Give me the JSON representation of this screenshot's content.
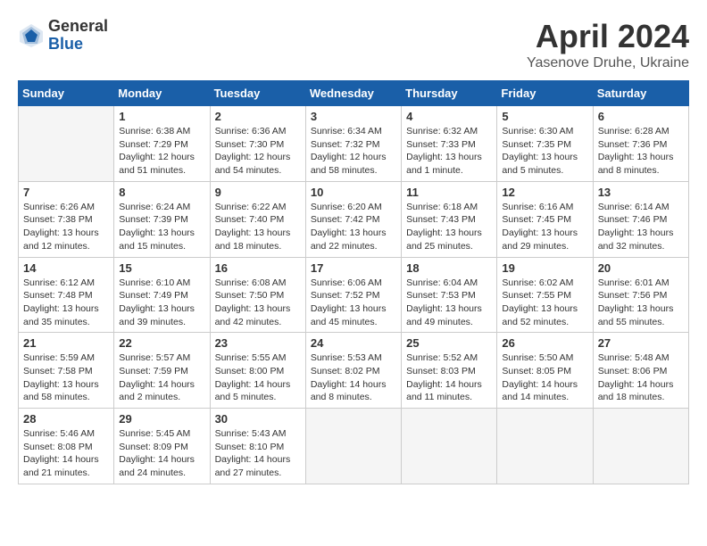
{
  "logo": {
    "general": "General",
    "blue": "Blue"
  },
  "title": {
    "month": "April 2024",
    "location": "Yasenove Druhe, Ukraine"
  },
  "calendar": {
    "headers": [
      "Sunday",
      "Monday",
      "Tuesday",
      "Wednesday",
      "Thursday",
      "Friday",
      "Saturday"
    ],
    "weeks": [
      [
        {
          "day": "",
          "info": ""
        },
        {
          "day": "1",
          "info": "Sunrise: 6:38 AM\nSunset: 7:29 PM\nDaylight: 12 hours\nand 51 minutes."
        },
        {
          "day": "2",
          "info": "Sunrise: 6:36 AM\nSunset: 7:30 PM\nDaylight: 12 hours\nand 54 minutes."
        },
        {
          "day": "3",
          "info": "Sunrise: 6:34 AM\nSunset: 7:32 PM\nDaylight: 12 hours\nand 58 minutes."
        },
        {
          "day": "4",
          "info": "Sunrise: 6:32 AM\nSunset: 7:33 PM\nDaylight: 13 hours\nand 1 minute."
        },
        {
          "day": "5",
          "info": "Sunrise: 6:30 AM\nSunset: 7:35 PM\nDaylight: 13 hours\nand 5 minutes."
        },
        {
          "day": "6",
          "info": "Sunrise: 6:28 AM\nSunset: 7:36 PM\nDaylight: 13 hours\nand 8 minutes."
        }
      ],
      [
        {
          "day": "7",
          "info": "Sunrise: 6:26 AM\nSunset: 7:38 PM\nDaylight: 13 hours\nand 12 minutes."
        },
        {
          "day": "8",
          "info": "Sunrise: 6:24 AM\nSunset: 7:39 PM\nDaylight: 13 hours\nand 15 minutes."
        },
        {
          "day": "9",
          "info": "Sunrise: 6:22 AM\nSunset: 7:40 PM\nDaylight: 13 hours\nand 18 minutes."
        },
        {
          "day": "10",
          "info": "Sunrise: 6:20 AM\nSunset: 7:42 PM\nDaylight: 13 hours\nand 22 minutes."
        },
        {
          "day": "11",
          "info": "Sunrise: 6:18 AM\nSunset: 7:43 PM\nDaylight: 13 hours\nand 25 minutes."
        },
        {
          "day": "12",
          "info": "Sunrise: 6:16 AM\nSunset: 7:45 PM\nDaylight: 13 hours\nand 29 minutes."
        },
        {
          "day": "13",
          "info": "Sunrise: 6:14 AM\nSunset: 7:46 PM\nDaylight: 13 hours\nand 32 minutes."
        }
      ],
      [
        {
          "day": "14",
          "info": "Sunrise: 6:12 AM\nSunset: 7:48 PM\nDaylight: 13 hours\nand 35 minutes."
        },
        {
          "day": "15",
          "info": "Sunrise: 6:10 AM\nSunset: 7:49 PM\nDaylight: 13 hours\nand 39 minutes."
        },
        {
          "day": "16",
          "info": "Sunrise: 6:08 AM\nSunset: 7:50 PM\nDaylight: 13 hours\nand 42 minutes."
        },
        {
          "day": "17",
          "info": "Sunrise: 6:06 AM\nSunset: 7:52 PM\nDaylight: 13 hours\nand 45 minutes."
        },
        {
          "day": "18",
          "info": "Sunrise: 6:04 AM\nSunset: 7:53 PM\nDaylight: 13 hours\nand 49 minutes."
        },
        {
          "day": "19",
          "info": "Sunrise: 6:02 AM\nSunset: 7:55 PM\nDaylight: 13 hours\nand 52 minutes."
        },
        {
          "day": "20",
          "info": "Sunrise: 6:01 AM\nSunset: 7:56 PM\nDaylight: 13 hours\nand 55 minutes."
        }
      ],
      [
        {
          "day": "21",
          "info": "Sunrise: 5:59 AM\nSunset: 7:58 PM\nDaylight: 13 hours\nand 58 minutes."
        },
        {
          "day": "22",
          "info": "Sunrise: 5:57 AM\nSunset: 7:59 PM\nDaylight: 14 hours\nand 2 minutes."
        },
        {
          "day": "23",
          "info": "Sunrise: 5:55 AM\nSunset: 8:00 PM\nDaylight: 14 hours\nand 5 minutes."
        },
        {
          "day": "24",
          "info": "Sunrise: 5:53 AM\nSunset: 8:02 PM\nDaylight: 14 hours\nand 8 minutes."
        },
        {
          "day": "25",
          "info": "Sunrise: 5:52 AM\nSunset: 8:03 PM\nDaylight: 14 hours\nand 11 minutes."
        },
        {
          "day": "26",
          "info": "Sunrise: 5:50 AM\nSunset: 8:05 PM\nDaylight: 14 hours\nand 14 minutes."
        },
        {
          "day": "27",
          "info": "Sunrise: 5:48 AM\nSunset: 8:06 PM\nDaylight: 14 hours\nand 18 minutes."
        }
      ],
      [
        {
          "day": "28",
          "info": "Sunrise: 5:46 AM\nSunset: 8:08 PM\nDaylight: 14 hours\nand 21 minutes."
        },
        {
          "day": "29",
          "info": "Sunrise: 5:45 AM\nSunset: 8:09 PM\nDaylight: 14 hours\nand 24 minutes."
        },
        {
          "day": "30",
          "info": "Sunrise: 5:43 AM\nSunset: 8:10 PM\nDaylight: 14 hours\nand 27 minutes."
        },
        {
          "day": "",
          "info": ""
        },
        {
          "day": "",
          "info": ""
        },
        {
          "day": "",
          "info": ""
        },
        {
          "day": "",
          "info": ""
        }
      ]
    ]
  }
}
